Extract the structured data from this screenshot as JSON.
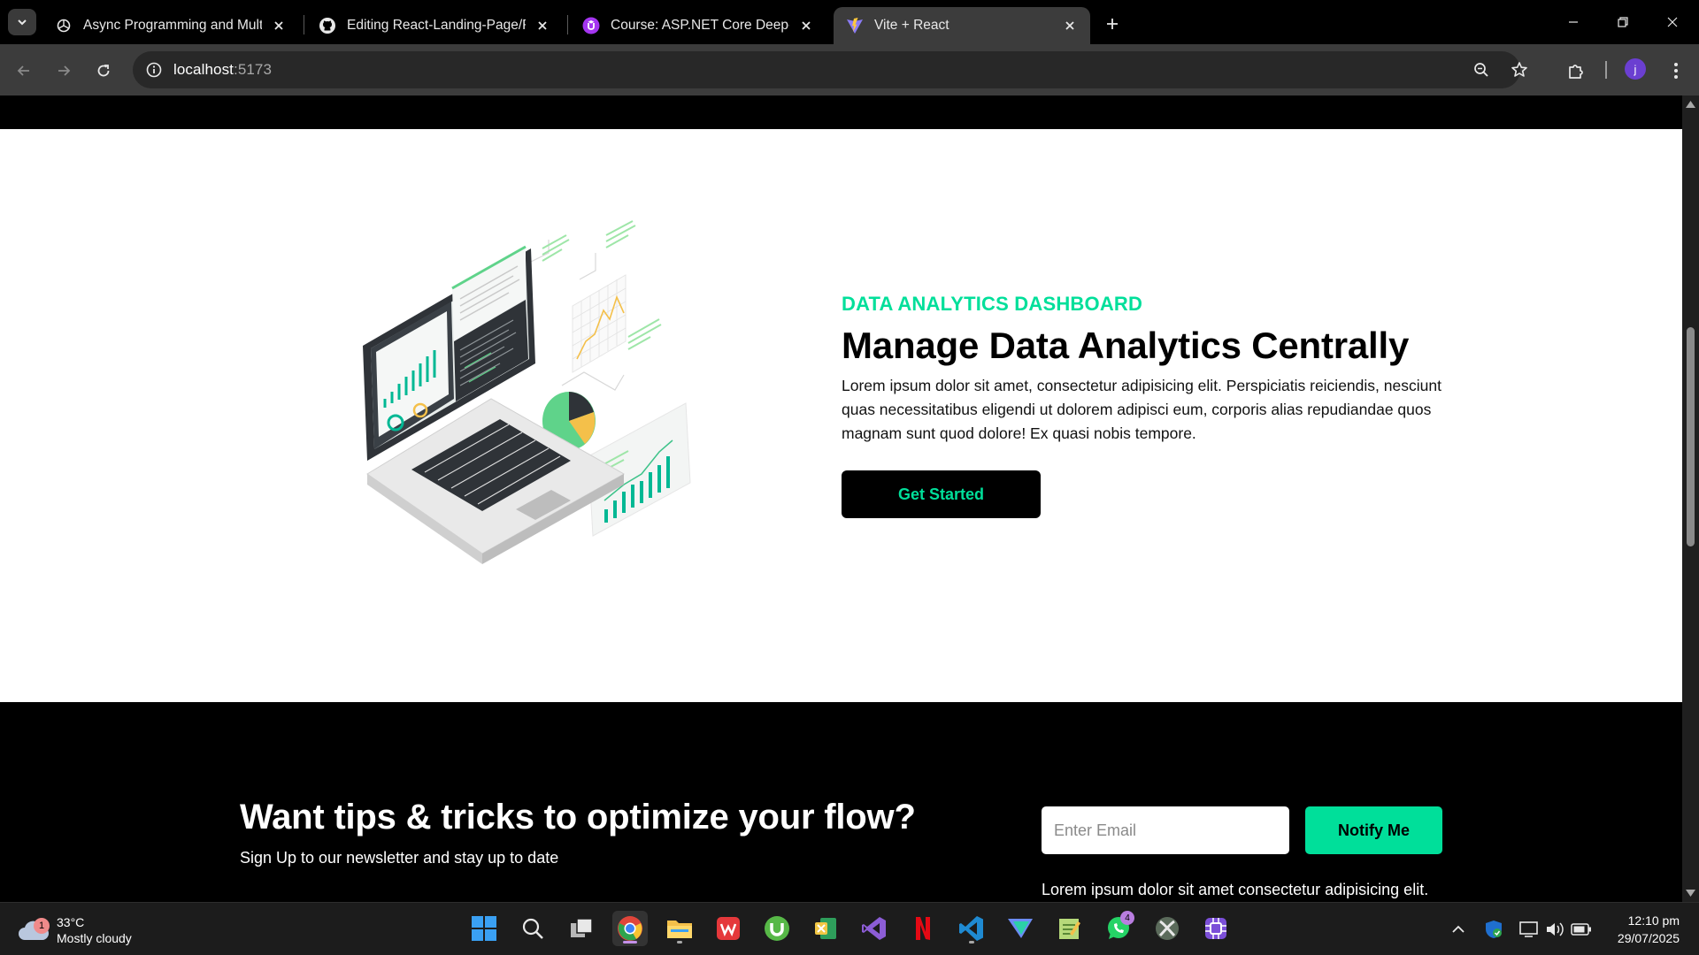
{
  "browser": {
    "tabs": [
      {
        "title": "Async Programming and Multit",
        "icon": "openai-icon",
        "active": false
      },
      {
        "title": "Editing React-Landing-Page/RE",
        "icon": "github-icon",
        "active": false
      },
      {
        "title": "Course: ASP.NET Core Deep-Div",
        "icon": "udemy-icon",
        "active": false
      },
      {
        "title": "Vite + React",
        "icon": "vite-icon",
        "active": true
      }
    ],
    "url_host": "localhost",
    "url_port": ":5173",
    "profile_initial": "j"
  },
  "hero": {
    "eyebrow": "DATA ANALYTICS DASHBOARD",
    "title": "Manage Data Analytics Centrally",
    "body": "Lorem ipsum dolor sit amet, consectetur adipisicing elit. Perspiciatis reiciendis, nesciunt quas necessitatibus eligendi ut dolorem adipisci eum, corporis alias repudiandae quos magnam sunt quod dolore! Ex quasi nobis tempore.",
    "cta_label": "Get Started"
  },
  "newsletter": {
    "title": "Want tips & tricks to optimize your flow?",
    "subtitle": "Sign Up to our newsletter and stay up to date",
    "email_placeholder": "Enter Email",
    "button_label": "Notify Me",
    "note": "Lorem ipsum dolor sit amet consectetur adipisicing elit."
  },
  "colors": {
    "accent": "#00df9a",
    "page_bg": "#000000",
    "hero_bg": "#ffffff"
  },
  "taskbar": {
    "weather_temp": "33°C",
    "weather_desc": "Mostly cloudy",
    "weather_badge": "1",
    "whatsapp_badge": "4",
    "time": "12:10 pm",
    "date": "29/07/2025",
    "apps": [
      "start",
      "search",
      "task-view",
      "chrome",
      "file-explorer",
      "wps-office",
      "utorrent",
      "excel",
      "visual-studio",
      "netflix",
      "vscode",
      "proton-vpn",
      "notepad",
      "whatsapp",
      "xbox",
      "app"
    ]
  }
}
